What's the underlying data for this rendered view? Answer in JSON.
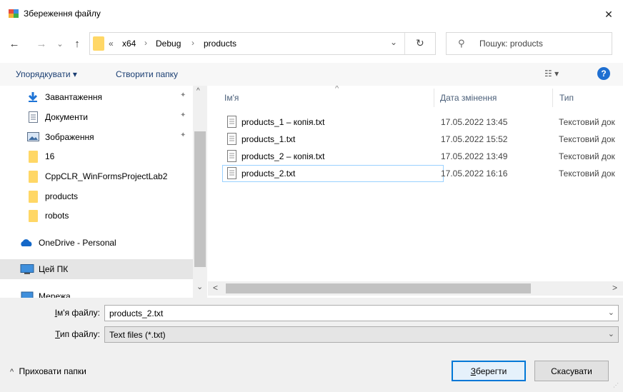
{
  "window": {
    "title": "Збереження файлу",
    "close_glyph": "✕"
  },
  "navigation": {
    "back_glyph": "←",
    "forward_glyph": "→",
    "recent_glyph": "⌄",
    "up_glyph": "↑",
    "breadcrumb": {
      "overflow": "«",
      "items": [
        "x64",
        "Debug",
        "products"
      ],
      "separator": "›",
      "dropdown_glyph": "⌄"
    },
    "refresh_glyph": "↻",
    "search": {
      "icon": "⚲",
      "placeholder": "Пошук: products"
    }
  },
  "toolbar": {
    "organize_label": "Упорядкувати ▾",
    "new_folder_label": "Створити папку",
    "view_glyph": "☷ ▾",
    "help_glyph": "?"
  },
  "sidebar": {
    "items": [
      {
        "label": "Завантаження",
        "icon": "download-icon",
        "pinned": true
      },
      {
        "label": "Документи",
        "icon": "document-icon",
        "pinned": true
      },
      {
        "label": "Зображення",
        "icon": "pictures-icon",
        "pinned": true
      },
      {
        "label": "16",
        "icon": "folder-icon",
        "pinned": false
      },
      {
        "label": "CppCLR_WinFormsProjectLab2",
        "icon": "folder-icon",
        "pinned": false
      },
      {
        "label": "products",
        "icon": "folder-icon",
        "pinned": false
      },
      {
        "label": "robots",
        "icon": "folder-icon",
        "pinned": false
      },
      {
        "label": "OneDrive - Personal",
        "icon": "cloud-icon",
        "pinned": false
      },
      {
        "label": "Цей ПК",
        "icon": "computer-icon",
        "pinned": false,
        "selected": true
      },
      {
        "label": "Мережа",
        "icon": "network-icon",
        "pinned": false
      }
    ],
    "pin_glyph": "📌"
  },
  "files": {
    "columns": [
      "Ім'я",
      "Дата змінення",
      "Тип"
    ],
    "sort_glyph": "^",
    "rows": [
      {
        "name": "products_1 – копія.txt",
        "date": "17.05.2022 13:45",
        "type": "Текстовий док"
      },
      {
        "name": "products_1.txt",
        "date": "17.05.2022 15:52",
        "type": "Текстовий док"
      },
      {
        "name": "products_2 – копія.txt",
        "date": "17.05.2022 13:49",
        "type": "Текстовий док"
      },
      {
        "name": "products_2.txt",
        "date": "17.05.2022 16:16",
        "type": "Текстовий док",
        "focused": true
      }
    ]
  },
  "scroll": {
    "up": "^",
    "down": "⌄",
    "left": "<",
    "right": ">"
  },
  "form": {
    "filename_label_underlined": "І",
    "filename_label_rest": "м'я файлу:",
    "filename_value": "products_2.txt",
    "filetype_label_underlined": "Т",
    "filetype_label_rest": "ип файлу:",
    "filetype_value": "Text files (*.txt)",
    "combo_arrow": "⌄"
  },
  "footer": {
    "hide_folders_glyph": "^",
    "hide_folders_label": "Приховати папки",
    "save_label_underlined": "З",
    "save_label_rest": "берегти",
    "cancel_label": "Скасувати"
  },
  "colors": {
    "accent": "#0078d7",
    "selected_bg": "#cce8ff",
    "hover_bg": "#e5e5e5",
    "folder": "#ffd766",
    "help_blue": "#1f6fd1"
  }
}
